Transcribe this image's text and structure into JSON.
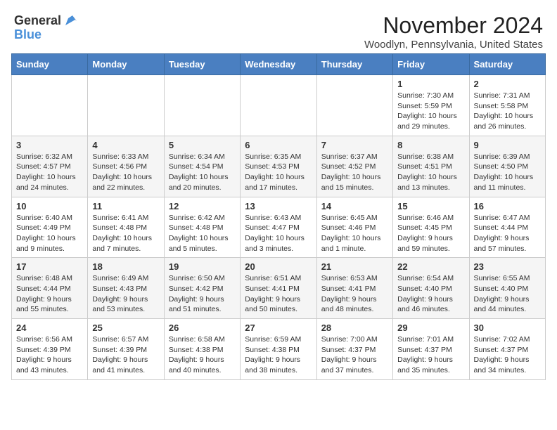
{
  "header": {
    "logo_general": "General",
    "logo_blue": "Blue",
    "month_title": "November 2024",
    "location": "Woodlyn, Pennsylvania, United States"
  },
  "weekdays": [
    "Sunday",
    "Monday",
    "Tuesday",
    "Wednesday",
    "Thursday",
    "Friday",
    "Saturday"
  ],
  "weeks": [
    [
      {
        "day": "",
        "info": ""
      },
      {
        "day": "",
        "info": ""
      },
      {
        "day": "",
        "info": ""
      },
      {
        "day": "",
        "info": ""
      },
      {
        "day": "",
        "info": ""
      },
      {
        "day": "1",
        "info": "Sunrise: 7:30 AM\nSunset: 5:59 PM\nDaylight: 10 hours and 29 minutes."
      },
      {
        "day": "2",
        "info": "Sunrise: 7:31 AM\nSunset: 5:58 PM\nDaylight: 10 hours and 26 minutes."
      }
    ],
    [
      {
        "day": "3",
        "info": "Sunrise: 6:32 AM\nSunset: 4:57 PM\nDaylight: 10 hours and 24 minutes."
      },
      {
        "day": "4",
        "info": "Sunrise: 6:33 AM\nSunset: 4:56 PM\nDaylight: 10 hours and 22 minutes."
      },
      {
        "day": "5",
        "info": "Sunrise: 6:34 AM\nSunset: 4:54 PM\nDaylight: 10 hours and 20 minutes."
      },
      {
        "day": "6",
        "info": "Sunrise: 6:35 AM\nSunset: 4:53 PM\nDaylight: 10 hours and 17 minutes."
      },
      {
        "day": "7",
        "info": "Sunrise: 6:37 AM\nSunset: 4:52 PM\nDaylight: 10 hours and 15 minutes."
      },
      {
        "day": "8",
        "info": "Sunrise: 6:38 AM\nSunset: 4:51 PM\nDaylight: 10 hours and 13 minutes."
      },
      {
        "day": "9",
        "info": "Sunrise: 6:39 AM\nSunset: 4:50 PM\nDaylight: 10 hours and 11 minutes."
      }
    ],
    [
      {
        "day": "10",
        "info": "Sunrise: 6:40 AM\nSunset: 4:49 PM\nDaylight: 10 hours and 9 minutes."
      },
      {
        "day": "11",
        "info": "Sunrise: 6:41 AM\nSunset: 4:48 PM\nDaylight: 10 hours and 7 minutes."
      },
      {
        "day": "12",
        "info": "Sunrise: 6:42 AM\nSunset: 4:48 PM\nDaylight: 10 hours and 5 minutes."
      },
      {
        "day": "13",
        "info": "Sunrise: 6:43 AM\nSunset: 4:47 PM\nDaylight: 10 hours and 3 minutes."
      },
      {
        "day": "14",
        "info": "Sunrise: 6:45 AM\nSunset: 4:46 PM\nDaylight: 10 hours and 1 minute."
      },
      {
        "day": "15",
        "info": "Sunrise: 6:46 AM\nSunset: 4:45 PM\nDaylight: 9 hours and 59 minutes."
      },
      {
        "day": "16",
        "info": "Sunrise: 6:47 AM\nSunset: 4:44 PM\nDaylight: 9 hours and 57 minutes."
      }
    ],
    [
      {
        "day": "17",
        "info": "Sunrise: 6:48 AM\nSunset: 4:44 PM\nDaylight: 9 hours and 55 minutes."
      },
      {
        "day": "18",
        "info": "Sunrise: 6:49 AM\nSunset: 4:43 PM\nDaylight: 9 hours and 53 minutes."
      },
      {
        "day": "19",
        "info": "Sunrise: 6:50 AM\nSunset: 4:42 PM\nDaylight: 9 hours and 51 minutes."
      },
      {
        "day": "20",
        "info": "Sunrise: 6:51 AM\nSunset: 4:41 PM\nDaylight: 9 hours and 50 minutes."
      },
      {
        "day": "21",
        "info": "Sunrise: 6:53 AM\nSunset: 4:41 PM\nDaylight: 9 hours and 48 minutes."
      },
      {
        "day": "22",
        "info": "Sunrise: 6:54 AM\nSunset: 4:40 PM\nDaylight: 9 hours and 46 minutes."
      },
      {
        "day": "23",
        "info": "Sunrise: 6:55 AM\nSunset: 4:40 PM\nDaylight: 9 hours and 44 minutes."
      }
    ],
    [
      {
        "day": "24",
        "info": "Sunrise: 6:56 AM\nSunset: 4:39 PM\nDaylight: 9 hours and 43 minutes."
      },
      {
        "day": "25",
        "info": "Sunrise: 6:57 AM\nSunset: 4:39 PM\nDaylight: 9 hours and 41 minutes."
      },
      {
        "day": "26",
        "info": "Sunrise: 6:58 AM\nSunset: 4:38 PM\nDaylight: 9 hours and 40 minutes."
      },
      {
        "day": "27",
        "info": "Sunrise: 6:59 AM\nSunset: 4:38 PM\nDaylight: 9 hours and 38 minutes."
      },
      {
        "day": "28",
        "info": "Sunrise: 7:00 AM\nSunset: 4:37 PM\nDaylight: 9 hours and 37 minutes."
      },
      {
        "day": "29",
        "info": "Sunrise: 7:01 AM\nSunset: 4:37 PM\nDaylight: 9 hours and 35 minutes."
      },
      {
        "day": "30",
        "info": "Sunrise: 7:02 AM\nSunset: 4:37 PM\nDaylight: 9 hours and 34 minutes."
      }
    ]
  ]
}
